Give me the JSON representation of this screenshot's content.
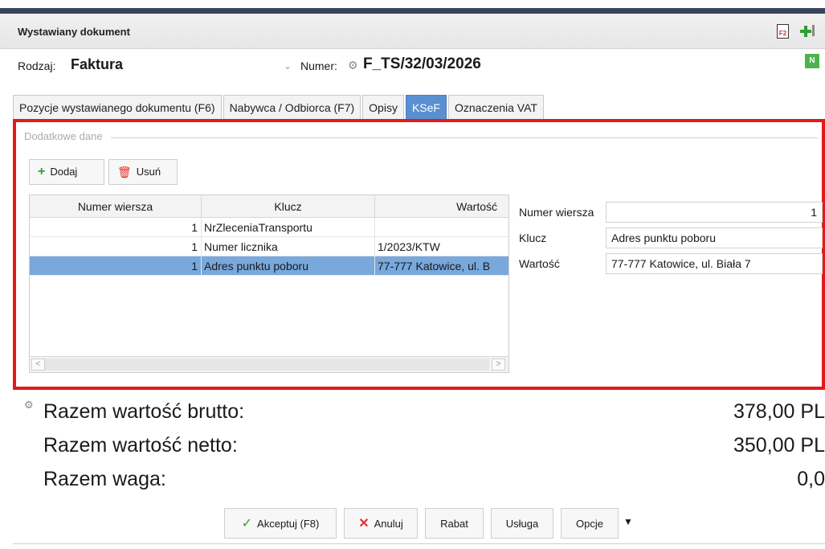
{
  "window": {
    "title": "Wystawiany dokument"
  },
  "document": {
    "type_label": "Rodzaj:",
    "type_value": "Faktura",
    "number_label": "Numer:",
    "number_value": "F_TS/32/03/2026",
    "badge": "N"
  },
  "tabs": [
    {
      "label": "Pozycje wystawianego dokumentu (F6)",
      "active": false
    },
    {
      "label": "Nabywca / Odbiorca (F7)",
      "active": false
    },
    {
      "label": "Opisy",
      "active": false
    },
    {
      "label": "KSeF",
      "active": true
    },
    {
      "label": "Oznaczenia VAT",
      "active": false
    }
  ],
  "extra": {
    "group_title": "Dodatkowe dane",
    "add_label": "Dodaj",
    "delete_label": "Usuń",
    "columns": [
      "Numer wiersza",
      "Klucz",
      "Wartość"
    ],
    "rows": [
      {
        "num": "1",
        "key": "NrZleceniaTransportu",
        "value": ""
      },
      {
        "num": "1",
        "key": "Numer licznika",
        "value": "1/2023/KTW"
      },
      {
        "num": "1",
        "key": "Adres punktu poboru",
        "value": "77-777 Katowice, ul. B",
        "selected": true
      }
    ],
    "form": {
      "num_label": "Numer wiersza",
      "num_value": "1",
      "key_label": "Klucz",
      "key_value": "Adres punktu poboru",
      "value_label": "Wartość",
      "value_value": "77-777 Katowice, ul. Biała 7"
    }
  },
  "totals": [
    {
      "label": "Razem wartość brutto:",
      "value": "378,00 PL"
    },
    {
      "label": "Razem wartość netto:",
      "value": "350,00 PL"
    },
    {
      "label": "Razem waga:",
      "value": "0,0"
    }
  ],
  "buttons": {
    "accept": "Akceptuj (F8)",
    "cancel": "Anuluj",
    "discount": "Rabat",
    "service": "Usługa",
    "options": "Opcje"
  },
  "colors": {
    "tab_active": "#5a8fd1",
    "selected_row": "#79a8dd",
    "highlight_border": "#e11b1b"
  }
}
